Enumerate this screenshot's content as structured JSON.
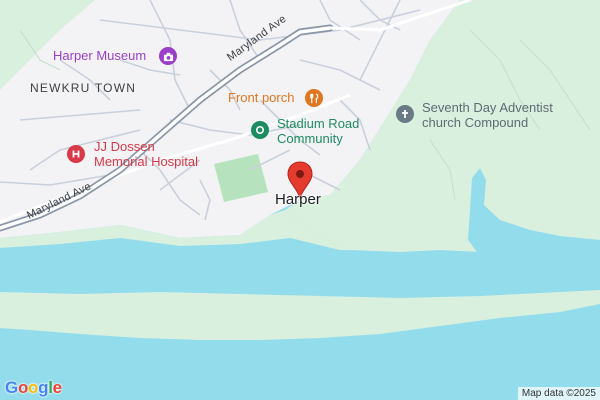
{
  "map": {
    "town_label": "Harper",
    "district_label": "NEWKRU TOWN",
    "roads": [
      {
        "id": "maryland-ave-upper",
        "name": "Maryland Ave"
      },
      {
        "id": "maryland-ave-lower",
        "name": "Maryland Ave"
      }
    ],
    "pois": [
      {
        "id": "harper-museum",
        "name": "Harper Museum",
        "icon": "museum-icon",
        "color": "#9b3fc9"
      },
      {
        "id": "front-porch",
        "name": "Front porch",
        "icon": "restaurant-icon",
        "color": "#e0761f"
      },
      {
        "id": "stadium-road-community",
        "line1": "Stadium Road",
        "line2": "Community",
        "icon": "park-icon",
        "color": "#1d8c61"
      },
      {
        "id": "seventh-day-adventist",
        "line1": "Seventh Day Adventist",
        "line2": "church Compound",
        "icon": "church-icon",
        "color": "#6b7b86"
      },
      {
        "id": "jj-dossen-hospital",
        "line1": "JJ Dossen",
        "line2": "Memorial Hospital",
        "icon": "hospital-icon",
        "color": "#d93848"
      }
    ],
    "pin": {
      "icon": "location-pin-icon",
      "color": "#e53a2e"
    },
    "colors": {
      "water": "#93dcec",
      "land": "#f3f3f5",
      "vegetation": "#d9f0df",
      "road": "#c9cfdb",
      "major_road": "#8b97a8",
      "field": "#b6e3bd"
    }
  },
  "footer": {
    "logo": "Google",
    "attribution": "Map data ©2025"
  }
}
